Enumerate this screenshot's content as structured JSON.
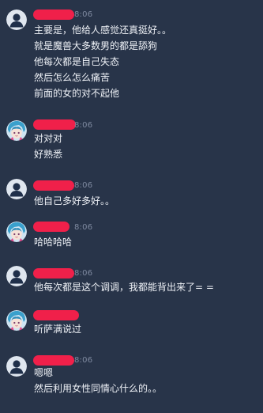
{
  "conversation": {
    "messages": [
      {
        "avatar": "default-user-avatar",
        "time": "8:06",
        "lines": [
          "主要是，他给人感觉还真挺好。。",
          "就是魔兽大多数男的都是舔狗",
          "他每次都是自己失态",
          "然后怎么怎么痛苦",
          "前面的女的对不起他"
        ]
      },
      {
        "avatar": "anime-girl-avatar",
        "time": "8:06",
        "lines": [
          "对对对",
          "好熟悉"
        ]
      },
      {
        "avatar": "default-user-avatar",
        "time": "8:06",
        "lines": [
          "他自己多好多好。。"
        ]
      },
      {
        "avatar": "anime-girl-avatar",
        "time": "8:06",
        "lines": [
          "哈哈哈哈"
        ]
      },
      {
        "avatar": "default-user-avatar",
        "time": "8:06",
        "lines": [
          "他每次都是这个调调，我都能背出来了= ="
        ]
      },
      {
        "avatar": "anime-girl-avatar",
        "time": "",
        "lines": [
          "听萨满说过"
        ]
      },
      {
        "avatar": "default-user-avatar",
        "time": "8:06",
        "lines": [
          "嗯嗯",
          "然后利用女性同情心什么的。。"
        ]
      }
    ]
  },
  "colors": {
    "background": "#283449",
    "text": "#eef1f6",
    "timestamp": "#7f8aa0",
    "redaction": "#f0204a"
  }
}
